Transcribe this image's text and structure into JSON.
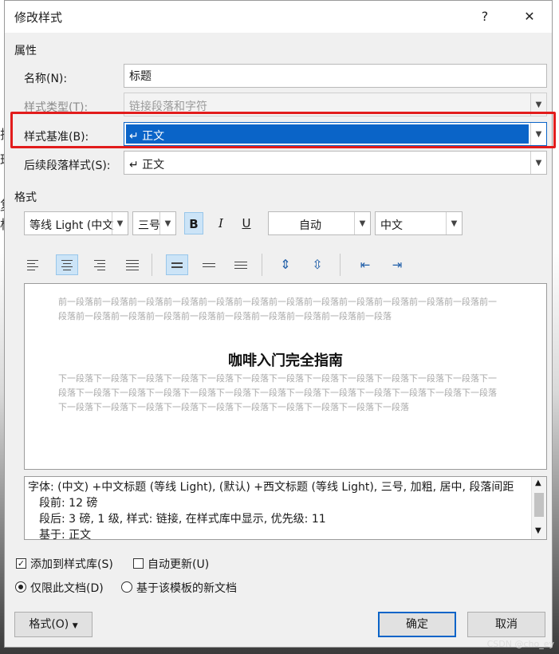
{
  "window": {
    "title": "修改样式",
    "help": "?",
    "close": "✕"
  },
  "properties": {
    "section": "属性",
    "name_label": "名称(N):",
    "name_value": "标题",
    "type_label": "样式类型(T):",
    "type_value": "链接段落和字符",
    "base_label": "样式基准(B):",
    "base_value": "↵ 正文",
    "next_label": "后续段落样式(S):",
    "next_value": "↵ 正文"
  },
  "format": {
    "section": "格式",
    "font": "等线 Light (中文",
    "size": "三号",
    "bold": "B",
    "italic": "I",
    "underline": "U",
    "color": "自动",
    "script": "中文"
  },
  "preview": {
    "prev_para": "前一段落前一段落前一段落前一段落前一段落前一段落前一段落前一段落前一段落前一段落前一段落前一段落前一段落前一段落前一段落前一段落前一段落前一段落前一段落前一段落前一段落前一段落",
    "heading": "咖啡入门完全指南",
    "next_para": "下一段落下一段落下一段落下一段落下一段落下一段落下一段落下一段落下一段落下一段落下一段落下一段落下一段落下一段落下一段落下一段落下一段落下一段落下一段落下一段落下一段落下一段落下一段落下一段落下一段落下一段落下一段落下一段落下一段落下一段落下一段落下一段落下一段落下一段落下一段落"
  },
  "description": {
    "line1": "字体: (中文) +中文标题 (等线 Light), (默认) +西文标题 (等线 Light), 三号, 加粗, 居中, 段落间距",
    "line2": "段前: 12 磅",
    "line3": "段后: 3 磅, 1 级, 样式: 链接, 在样式库中显示, 优先级: 11",
    "line4": "基于: 正文"
  },
  "options": {
    "add_gallery": "添加到样式库(S)",
    "auto_update": "自动更新(U)",
    "this_doc": "仅限此文档(D)",
    "template": "基于该模板的新文档"
  },
  "buttons": {
    "format": "格式(O)",
    "ok": "确定",
    "cancel": "取消"
  },
  "background": {
    "left_chars": [
      "排",
      "球",
      "复",
      "杯"
    ]
  },
  "watermark": "CSDN @cho_ey"
}
